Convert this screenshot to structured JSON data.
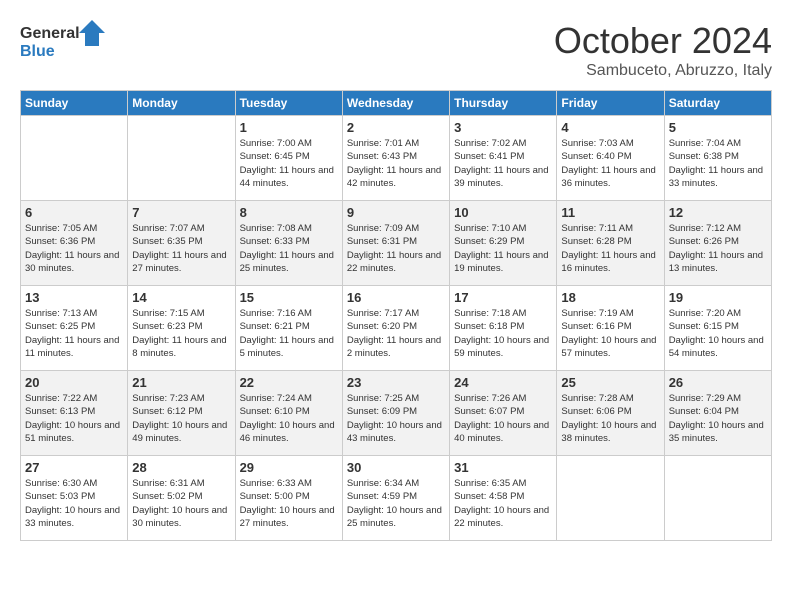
{
  "header": {
    "logo_line1": "General",
    "logo_line2": "Blue",
    "month": "October 2024",
    "location": "Sambuceto, Abruzzo, Italy"
  },
  "days_of_week": [
    "Sunday",
    "Monday",
    "Tuesday",
    "Wednesday",
    "Thursday",
    "Friday",
    "Saturday"
  ],
  "weeks": [
    [
      null,
      null,
      {
        "day": 1,
        "sunrise": "7:00 AM",
        "sunset": "6:45 PM",
        "daylight": "11 hours and 44 minutes."
      },
      {
        "day": 2,
        "sunrise": "7:01 AM",
        "sunset": "6:43 PM",
        "daylight": "11 hours and 42 minutes."
      },
      {
        "day": 3,
        "sunrise": "7:02 AM",
        "sunset": "6:41 PM",
        "daylight": "11 hours and 39 minutes."
      },
      {
        "day": 4,
        "sunrise": "7:03 AM",
        "sunset": "6:40 PM",
        "daylight": "11 hours and 36 minutes."
      },
      {
        "day": 5,
        "sunrise": "7:04 AM",
        "sunset": "6:38 PM",
        "daylight": "11 hours and 33 minutes."
      }
    ],
    [
      {
        "day": 6,
        "sunrise": "7:05 AM",
        "sunset": "6:36 PM",
        "daylight": "11 hours and 30 minutes."
      },
      {
        "day": 7,
        "sunrise": "7:07 AM",
        "sunset": "6:35 PM",
        "daylight": "11 hours and 27 minutes."
      },
      {
        "day": 8,
        "sunrise": "7:08 AM",
        "sunset": "6:33 PM",
        "daylight": "11 hours and 25 minutes."
      },
      {
        "day": 9,
        "sunrise": "7:09 AM",
        "sunset": "6:31 PM",
        "daylight": "11 hours and 22 minutes."
      },
      {
        "day": 10,
        "sunrise": "7:10 AM",
        "sunset": "6:29 PM",
        "daylight": "11 hours and 19 minutes."
      },
      {
        "day": 11,
        "sunrise": "7:11 AM",
        "sunset": "6:28 PM",
        "daylight": "11 hours and 16 minutes."
      },
      {
        "day": 12,
        "sunrise": "7:12 AM",
        "sunset": "6:26 PM",
        "daylight": "11 hours and 13 minutes."
      }
    ],
    [
      {
        "day": 13,
        "sunrise": "7:13 AM",
        "sunset": "6:25 PM",
        "daylight": "11 hours and 11 minutes."
      },
      {
        "day": 14,
        "sunrise": "7:15 AM",
        "sunset": "6:23 PM",
        "daylight": "11 hours and 8 minutes."
      },
      {
        "day": 15,
        "sunrise": "7:16 AM",
        "sunset": "6:21 PM",
        "daylight": "11 hours and 5 minutes."
      },
      {
        "day": 16,
        "sunrise": "7:17 AM",
        "sunset": "6:20 PM",
        "daylight": "11 hours and 2 minutes."
      },
      {
        "day": 17,
        "sunrise": "7:18 AM",
        "sunset": "6:18 PM",
        "daylight": "10 hours and 59 minutes."
      },
      {
        "day": 18,
        "sunrise": "7:19 AM",
        "sunset": "6:16 PM",
        "daylight": "10 hours and 57 minutes."
      },
      {
        "day": 19,
        "sunrise": "7:20 AM",
        "sunset": "6:15 PM",
        "daylight": "10 hours and 54 minutes."
      }
    ],
    [
      {
        "day": 20,
        "sunrise": "7:22 AM",
        "sunset": "6:13 PM",
        "daylight": "10 hours and 51 minutes."
      },
      {
        "day": 21,
        "sunrise": "7:23 AM",
        "sunset": "6:12 PM",
        "daylight": "10 hours and 49 minutes."
      },
      {
        "day": 22,
        "sunrise": "7:24 AM",
        "sunset": "6:10 PM",
        "daylight": "10 hours and 46 minutes."
      },
      {
        "day": 23,
        "sunrise": "7:25 AM",
        "sunset": "6:09 PM",
        "daylight": "10 hours and 43 minutes."
      },
      {
        "day": 24,
        "sunrise": "7:26 AM",
        "sunset": "6:07 PM",
        "daylight": "10 hours and 40 minutes."
      },
      {
        "day": 25,
        "sunrise": "7:28 AM",
        "sunset": "6:06 PM",
        "daylight": "10 hours and 38 minutes."
      },
      {
        "day": 26,
        "sunrise": "7:29 AM",
        "sunset": "6:04 PM",
        "daylight": "10 hours and 35 minutes."
      }
    ],
    [
      {
        "day": 27,
        "sunrise": "6:30 AM",
        "sunset": "5:03 PM",
        "daylight": "10 hours and 33 minutes."
      },
      {
        "day": 28,
        "sunrise": "6:31 AM",
        "sunset": "5:02 PM",
        "daylight": "10 hours and 30 minutes."
      },
      {
        "day": 29,
        "sunrise": "6:33 AM",
        "sunset": "5:00 PM",
        "daylight": "10 hours and 27 minutes."
      },
      {
        "day": 30,
        "sunrise": "6:34 AM",
        "sunset": "4:59 PM",
        "daylight": "10 hours and 25 minutes."
      },
      {
        "day": 31,
        "sunrise": "6:35 AM",
        "sunset": "4:58 PM",
        "daylight": "10 hours and 22 minutes."
      },
      null,
      null
    ]
  ],
  "labels": {
    "sunrise": "Sunrise:",
    "sunset": "Sunset:",
    "daylight": "Daylight:"
  }
}
